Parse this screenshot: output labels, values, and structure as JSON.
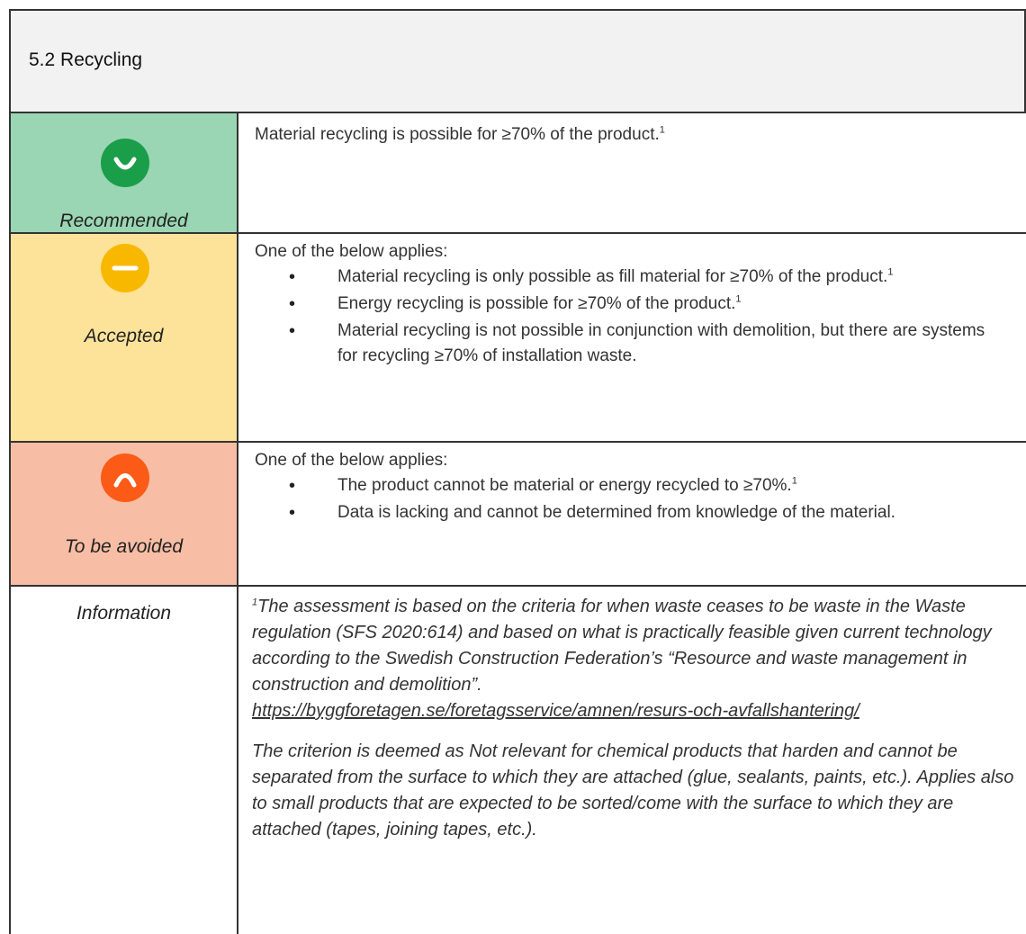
{
  "header": {
    "title": "5.2 Recycling"
  },
  "colors": {
    "recommended_bg": "#9ad6b3",
    "accepted_bg": "#fde39a",
    "avoided_bg": "#f8bda5",
    "header_bg": "#f2f2f2",
    "recommended_icon": "#1a9e4a",
    "accepted_icon": "#f9b800",
    "avoided_icon": "#fb5b16"
  },
  "recommended": {
    "label": "Recommended",
    "icon": "smile-face-icon",
    "text": "Material recycling is possible for ≥70% of the product.",
    "footnote_ref": "1"
  },
  "accepted": {
    "label": "Accepted",
    "icon": "neutral-face-icon",
    "intro": "One of the below applies:",
    "items": [
      {
        "text": "Material recycling is only possible as fill material for ≥70% of the product.",
        "ref": "1"
      },
      {
        "text": "Energy recycling is possible for ≥70% of the product.",
        "ref": "1"
      },
      {
        "text": "Material recycling is not possible in conjunction with demolition, but there are systems for recycling ≥70% of installation waste.",
        "ref": ""
      }
    ]
  },
  "avoided": {
    "label": "To be avoided",
    "icon": "frown-face-icon",
    "intro": "One of the below applies:",
    "items": [
      {
        "text": "The product cannot be material or energy recycled to ≥70%.",
        "ref": "1"
      },
      {
        "text": "Data is lacking and cannot be determined from knowledge of the material.",
        "ref": ""
      }
    ]
  },
  "information": {
    "label": "Information",
    "footnote_mark": "1",
    "paragraph1": "The assessment is based on the criteria for when waste ceases to be waste in the Waste regulation (SFS 2020:614) and based on what is practically feasible given current technology according to the Swedish Construction Federation’s “Resource and waste management in construction and demolition”.",
    "link": "https://byggforetagen.se/foretagsservice/amnen/resurs-och-avfallshantering/",
    "paragraph2": "The criterion is deemed as Not relevant for chemical products that harden and cannot be separated from the surface to which they are attached (glue, sealants, paints, etc.). Applies also to small products that are expected to be sorted/come with the surface to which they are attached (tapes, joining tapes, etc.)."
  }
}
